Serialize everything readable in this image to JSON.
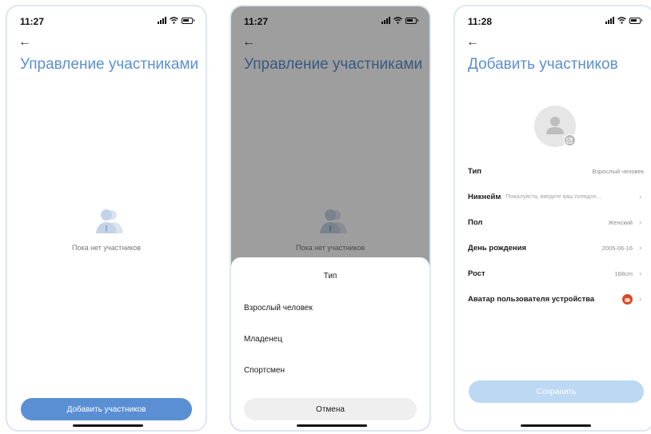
{
  "screen1": {
    "time": "11:27",
    "title": "Управление участниками",
    "empty_text": "Пока нет участников",
    "add_button": "Добавить участников"
  },
  "screen2": {
    "time": "11:27",
    "title": "Управление участниками",
    "empty_text": "Пока нет участников",
    "sheet": {
      "title": "Тип",
      "options": [
        "Взрослый человек",
        "Младенец",
        "Спортсмен"
      ],
      "cancel": "Отмена"
    }
  },
  "screen3": {
    "time": "11:28",
    "title": "Добавить участников",
    "fields": [
      {
        "label": "Тип",
        "value": "Взрослый человек"
      },
      {
        "label": "Никнейм",
        "placeholder": "Пожалуйста, введите ваш псевдон..."
      },
      {
        "label": "Пол",
        "value": "Женский"
      },
      {
        "label": "День рождения",
        "value": "2005-06-16"
      },
      {
        "label": "Рост",
        "value": "168cm"
      },
      {
        "label": "Аватар пользователя устройства"
      }
    ],
    "save_button": "Сохранить"
  },
  "icons": {
    "back": "back-arrow-icon",
    "chevron": "chevron-right-icon",
    "status_location": "location-arrow-icon",
    "status_signal": "signal-icon",
    "status_wifi": "wifi-icon",
    "status_battery": "battery-icon",
    "empty": "users-icon",
    "avatar": "person-placeholder-icon",
    "avatar_edit": "edit-icon"
  },
  "colors": {
    "title": "#5b8fd0",
    "primary_button": "#5a8fd4",
    "save_button_disabled": "#bcd8f2",
    "overlay": "rgba(0,0,0,0.38)"
  }
}
